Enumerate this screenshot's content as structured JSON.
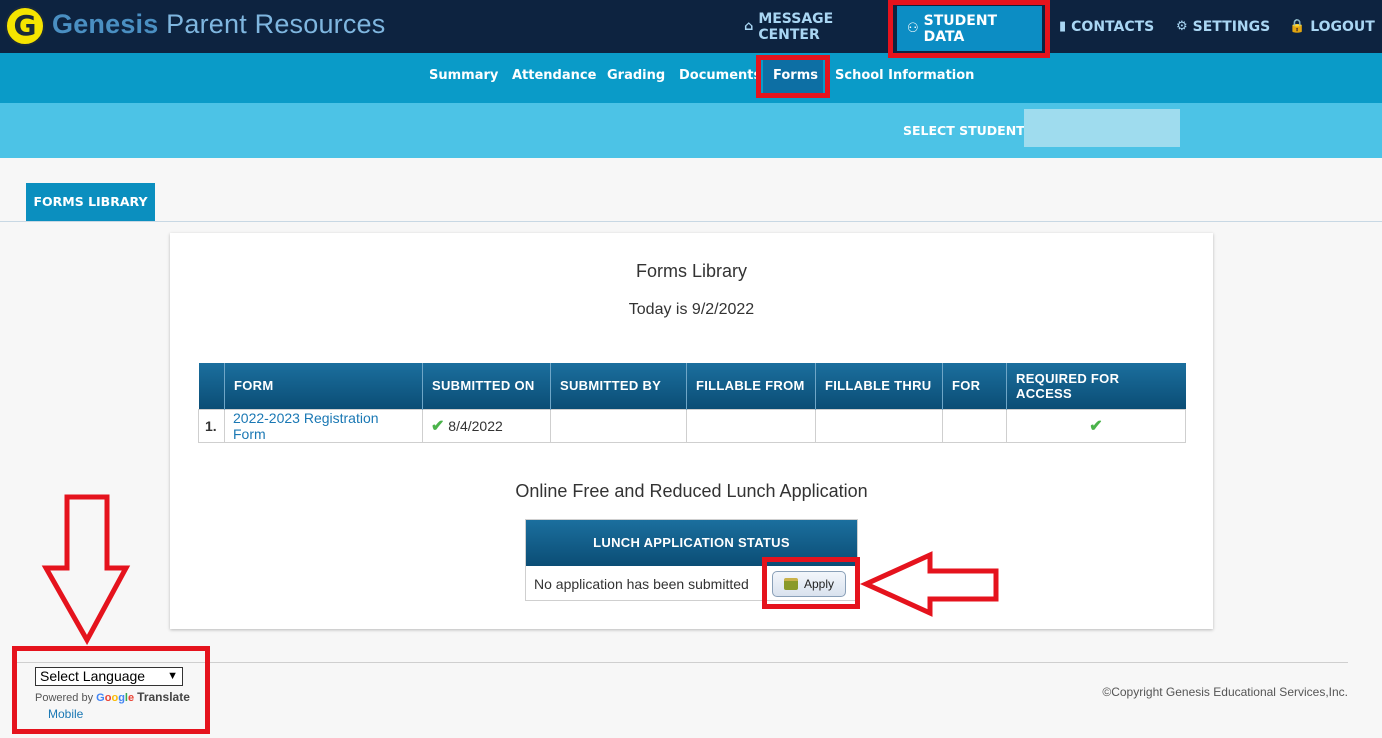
{
  "header": {
    "logo_letter": "G",
    "brand_word": "Genesis",
    "brand_rest": "Parent Resources",
    "nav": [
      {
        "label": "MESSAGE CENTER",
        "icon": "home-icon"
      },
      {
        "label": "STUDENT DATA",
        "icon": "users-icon"
      },
      {
        "label": "CONTACTS",
        "icon": "book-icon"
      },
      {
        "label": "SETTINGS",
        "icon": "gear-icon"
      },
      {
        "label": "LOGOUT",
        "icon": "lock-icon"
      }
    ]
  },
  "subnav": {
    "items": [
      "Summary",
      "Attendance",
      "Grading",
      "Documents",
      "Forms",
      "School Information"
    ]
  },
  "student_bar": {
    "label": "SELECT STUDENT"
  },
  "tab": {
    "label": "FORMS LIBRARY"
  },
  "card": {
    "title": "Forms Library",
    "date": "Today is 9/2/2022",
    "table": {
      "headers": [
        "FORM",
        "SUBMITTED ON",
        "SUBMITTED BY",
        "FILLABLE FROM",
        "FILLABLE THRU",
        "FOR",
        "REQUIRED FOR ACCESS"
      ],
      "rows": [
        {
          "num": "1.",
          "form": "2022-2023 Registration Form",
          "submitted_on": "8/4/2022",
          "submitted_by": "",
          "fillable_from": "",
          "fillable_thru": "",
          "for": "",
          "required": true
        }
      ]
    },
    "lunch": {
      "title": "Online Free and Reduced Lunch Application",
      "header": "LUNCH APPLICATION STATUS",
      "message": "No application has been submitted",
      "apply_label": "Apply"
    }
  },
  "footer": {
    "language_select": "Select Language",
    "powered_by": "Powered by",
    "google": "Google",
    "translate": "Translate",
    "mobile": "Mobile",
    "copyright": "©Copyright Genesis Educational Services,Inc."
  },
  "colors": {
    "header_bg": "#0d2340",
    "subnav_bg": "#0a9bc8",
    "student_bar_bg": "#4cc3e6",
    "annotation_red": "#e5131d"
  }
}
